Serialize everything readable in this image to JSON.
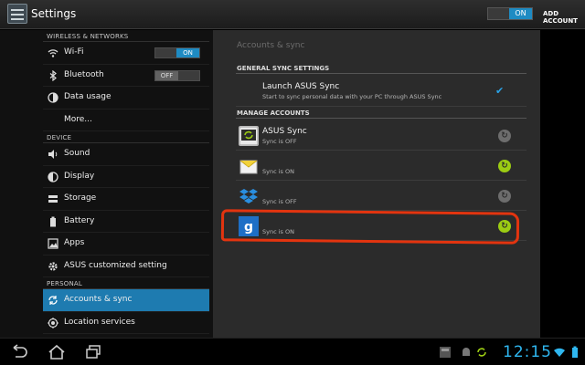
{
  "action_bar": {
    "title": "Settings",
    "master_sync_toggle": "ON",
    "add_account_label": "ADD ACCOUNT"
  },
  "sidebar": {
    "sections": [
      {
        "header": "WIRELESS & NETWORKS",
        "items": [
          {
            "label": "Wi-Fi",
            "icon": "wifi-icon",
            "toggle": "ON"
          },
          {
            "label": "Bluetooth",
            "icon": "bluetooth-icon",
            "toggle": "OFF"
          },
          {
            "label": "Data usage",
            "icon": "data-usage-icon"
          },
          {
            "label": "More..."
          }
        ]
      },
      {
        "header": "DEVICE",
        "items": [
          {
            "label": "Sound",
            "icon": "speaker-icon"
          },
          {
            "label": "Display",
            "icon": "display-icon"
          },
          {
            "label": "Storage",
            "icon": "storage-icon"
          },
          {
            "label": "Battery",
            "icon": "battery-icon"
          },
          {
            "label": "Apps",
            "icon": "apps-icon"
          },
          {
            "label": "ASUS customized setting",
            "icon": "gear-icon"
          }
        ]
      },
      {
        "header": "PERSONAL",
        "items": [
          {
            "label": "Accounts & sync",
            "icon": "sync-icon",
            "selected": true
          },
          {
            "label": "Location services",
            "icon": "location-icon"
          }
        ]
      }
    ]
  },
  "main": {
    "title": "Accounts & sync",
    "general_header": "GENERAL SYNC SETTINGS",
    "launch": {
      "title": "Launch ASUS Sync",
      "subtitle": "Start to sync personal data with your PC through ASUS Sync",
      "checked": true
    },
    "manage_header": "MANAGE ACCOUNTS",
    "accounts": [
      {
        "name": "ASUS Sync",
        "status": "Sync is OFF",
        "icon": "asus-sync-icon",
        "sync_on": false
      },
      {
        "name": "",
        "status": "Sync is ON",
        "icon": "email-icon",
        "sync_on": true
      },
      {
        "name": "",
        "status": "Sync is OFF",
        "icon": "dropbox-icon",
        "sync_on": false
      },
      {
        "name": "",
        "status": "Sync is ON",
        "icon": "google-icon",
        "sync_on": true
      }
    ]
  },
  "system_bar": {
    "clock": "12:15"
  },
  "colors": {
    "accent": "#1e7bb0",
    "sync_on": "#9ccc13",
    "annotation": "#e3340f",
    "clock": "#2fb7f0"
  }
}
